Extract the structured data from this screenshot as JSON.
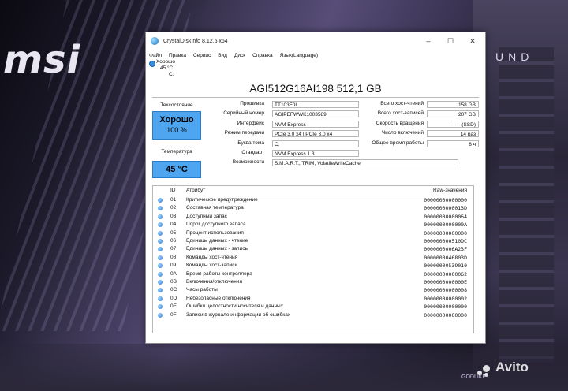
{
  "background": {
    "logo_text": "msi",
    "corner_text": "UND",
    "board_label": "GODLIKE",
    "watermark": "Avito"
  },
  "window": {
    "title": "CrystalDiskInfo 8.12.5 x64",
    "controls": [
      "–",
      "☐",
      "✕"
    ],
    "menu": [
      "Файл",
      "Правка",
      "Сервис",
      "Вид",
      "Диск",
      "Справка",
      "Язык(Language)"
    ],
    "drive_tab": {
      "status": "Хорошо",
      "temp": "45 °C",
      "letter": "C:"
    },
    "disk_title": "AGI512G16AI198 512,1 GB",
    "health": {
      "label": "Техсостояние",
      "status": "Хорошо",
      "percent": "100 %"
    },
    "temperature": {
      "label": "Температура",
      "value": "45 °C"
    },
    "left_info": [
      {
        "label": "Прошивка",
        "value": "TT103F0L"
      },
      {
        "label": "Серийный номер",
        "value": "AGIPEFWWK1003589"
      },
      {
        "label": "Интерфейс",
        "value": "NVM Express"
      },
      {
        "label": "Режим передачи",
        "value": "PCIe 3.0 x4 | PCIe 3.0 x4"
      },
      {
        "label": "Буква тома",
        "value": "C:"
      },
      {
        "label": "Стандарт",
        "value": "NVM Express 1.3"
      },
      {
        "label": "Возможности",
        "value": "S.M.A.R.T., TRIM, VolatileWriteCache"
      }
    ],
    "right_info": [
      {
        "label": "Всего хост-чтений",
        "value": "158 GB"
      },
      {
        "label": "Всего хост-записей",
        "value": "207 GB"
      },
      {
        "label": "Скорость вращения",
        "value": "---- (SSD)"
      },
      {
        "label": "Число включений",
        "value": "14 раз"
      },
      {
        "label": "Общее время работы",
        "value": "8 ч"
      }
    ],
    "attributes": {
      "headers": {
        "id": "ID",
        "name": "Атрибут",
        "raw": "Raw-значения"
      },
      "rows": [
        {
          "id": "01",
          "name": "Критическое предупреждение",
          "raw": "00000000000000"
        },
        {
          "id": "02",
          "name": "Составная температура",
          "raw": "0000000000013D"
        },
        {
          "id": "03",
          "name": "Доступный запас",
          "raw": "00000000000064"
        },
        {
          "id": "04",
          "name": "Порог доступного запаса",
          "raw": "0000000000000A"
        },
        {
          "id": "05",
          "name": "Процент использования",
          "raw": "00000000000000"
        },
        {
          "id": "06",
          "name": "Единицы данных - чтение",
          "raw": "000000000510DC"
        },
        {
          "id": "07",
          "name": "Единицы данных - запись",
          "raw": "0000000006A23F"
        },
        {
          "id": "08",
          "name": "Команды хост-чтения",
          "raw": "0000000046803D"
        },
        {
          "id": "09",
          "name": "Команды хост-записи",
          "raw": "00000000539010"
        },
        {
          "id": "0A",
          "name": "Время работы контроллера",
          "raw": "00000000000062"
        },
        {
          "id": "0B",
          "name": "Включения/отключения",
          "raw": "0000000000000E"
        },
        {
          "id": "0C",
          "name": "Часы работы",
          "raw": "00000000000008"
        },
        {
          "id": "0D",
          "name": "Небезопасные отключения",
          "raw": "00000000000002"
        },
        {
          "id": "0E",
          "name": "Ошибки целостности носителя и данных",
          "raw": "00000000000000"
        },
        {
          "id": "0F",
          "name": "Записи в журнале информации об ошибках",
          "raw": "00000000000000"
        }
      ]
    }
  }
}
